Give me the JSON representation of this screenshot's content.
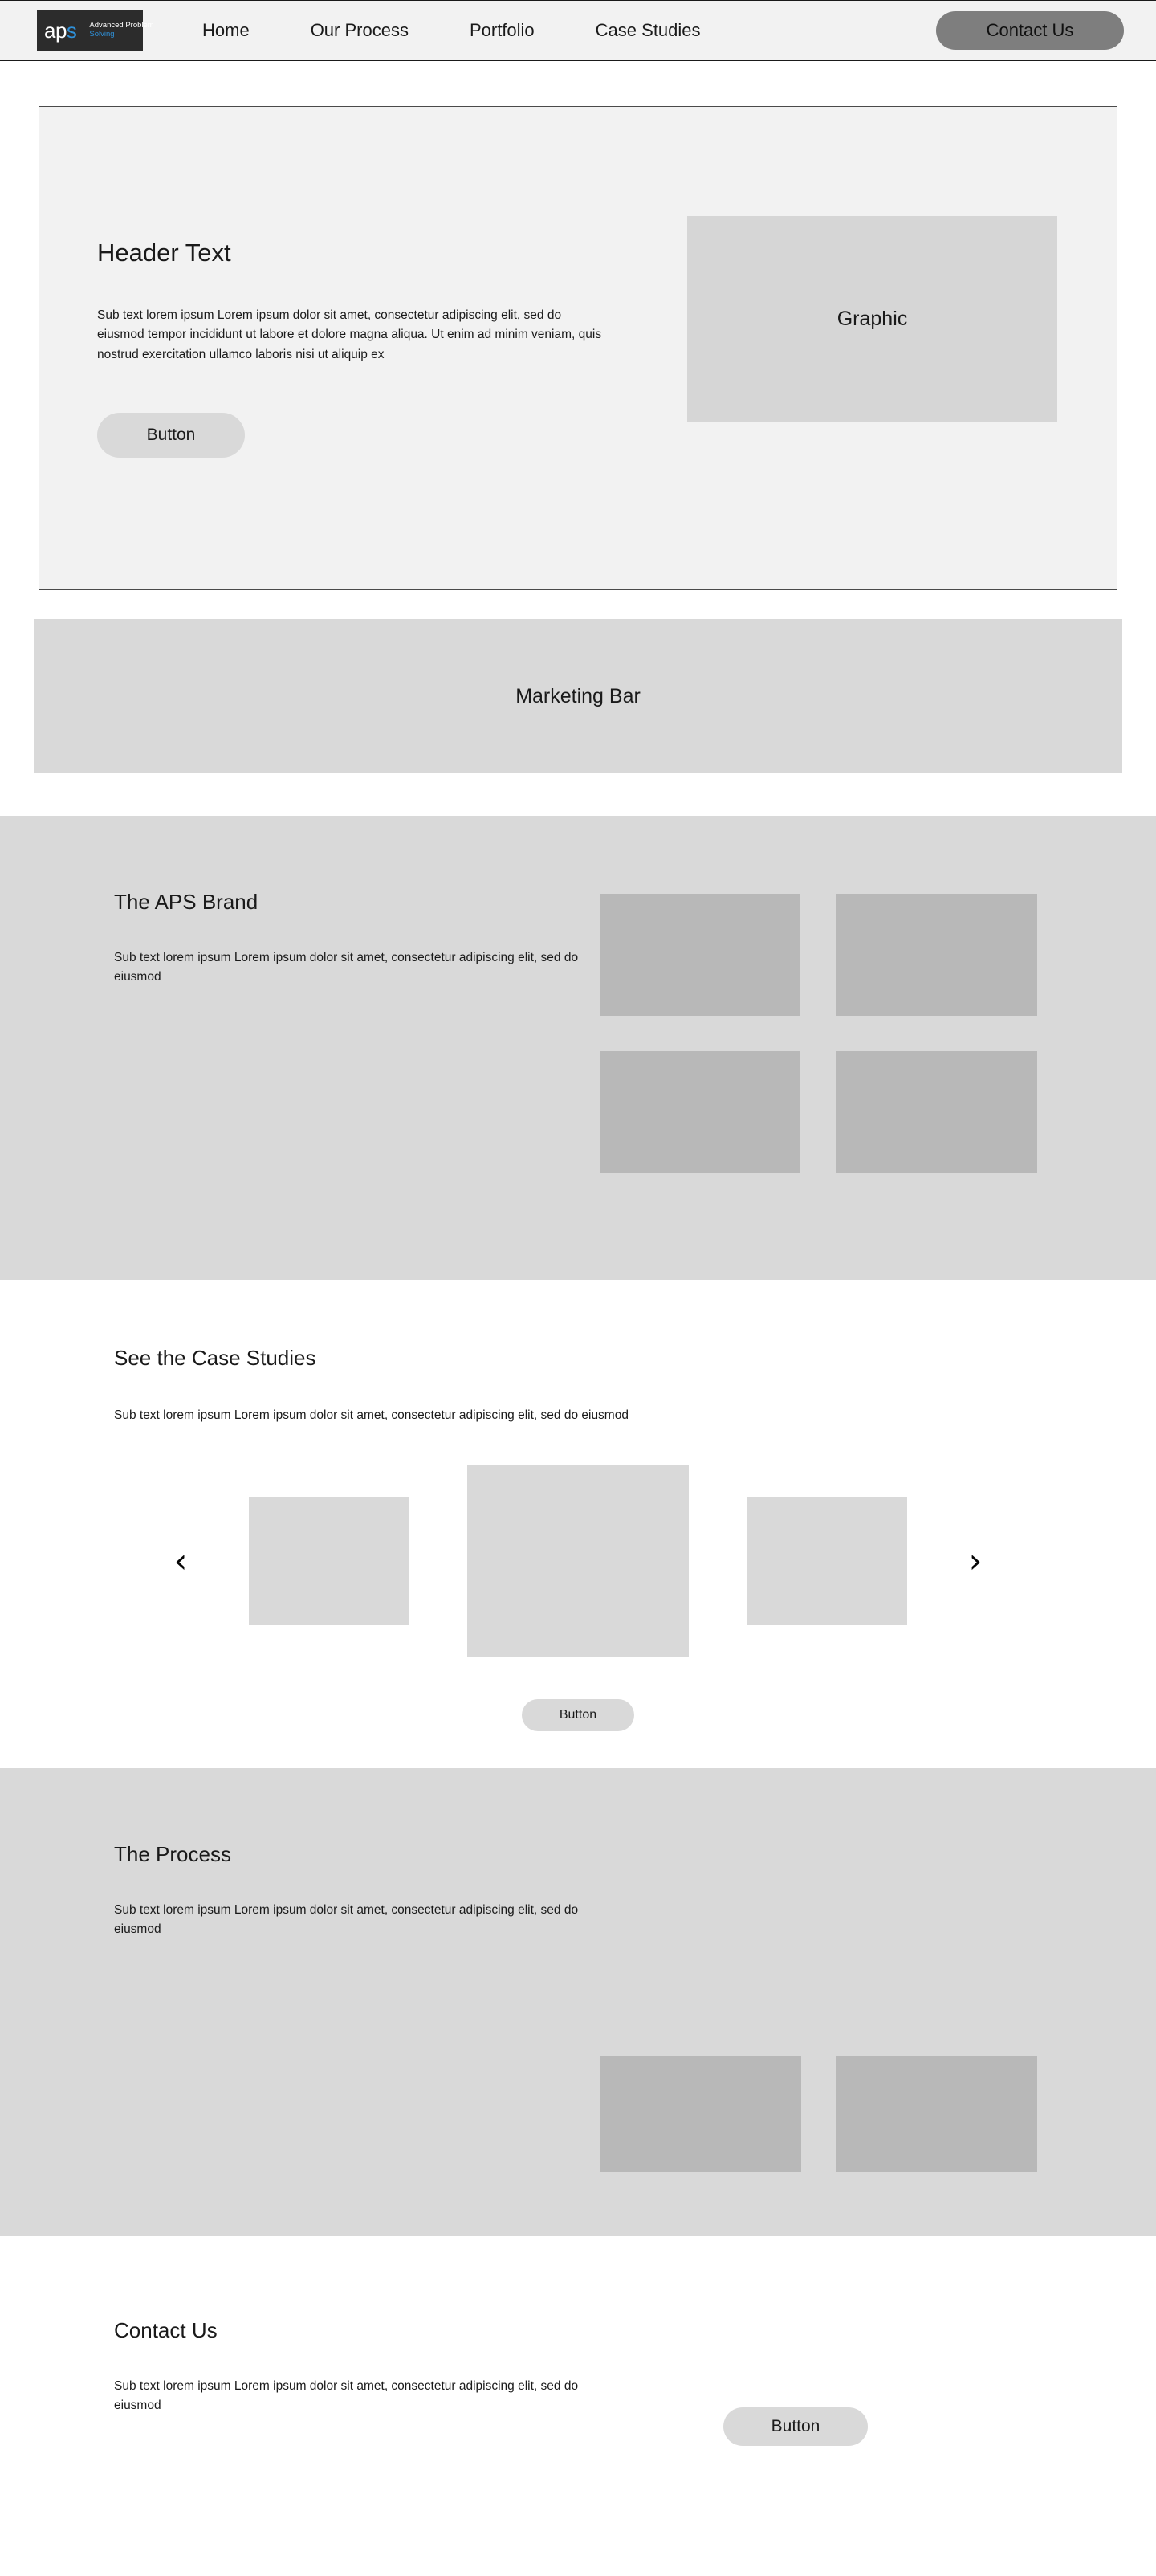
{
  "navbar": {
    "logo": {
      "mark_prefix": "ap",
      "mark_accent": "s",
      "tagline_line1": "Advanced Problem",
      "tagline_line2": "Solving"
    },
    "links": [
      {
        "label": "Home"
      },
      {
        "label": "Our Process"
      },
      {
        "label": "Portfolio"
      },
      {
        "label": "Case Studies"
      }
    ],
    "cta_label": "Contact Us",
    "cta_color": "#7e7e7e"
  },
  "hero": {
    "title": "Header Text",
    "subtext": "Sub text lorem ipsum Lorem ipsum dolor sit amet, consectetur adipiscing elit, sed do eiusmod tempor incididunt ut labore et dolore magna aliqua. Ut enim ad minim veniam, quis nostrud exercitation ullamco laboris nisi ut aliquip ex",
    "button_label": "Button",
    "graphic_label": "Graphic"
  },
  "marketing": {
    "label": "Marketing Bar"
  },
  "brand": {
    "title": "The APS Brand",
    "subtext": "Sub text lorem ipsum Lorem ipsum dolor sit amet, consectetur adipiscing elit, sed do eiusmod",
    "tiles": [
      {
        "name": "brand-image-1"
      },
      {
        "name": "brand-image-2"
      },
      {
        "name": "brand-image-3"
      },
      {
        "name": "brand-image-4"
      }
    ]
  },
  "case_studies": {
    "title": "See the Case Studies",
    "subtext": "Sub text lorem ipsum Lorem ipsum dolor sit amet, consectetur adipiscing elit, sed do eiusmod",
    "prev_icon": "‹",
    "next_icon": "›",
    "button_label": "Button"
  },
  "process": {
    "title": "The Process",
    "subtext": "Sub text lorem ipsum Lorem ipsum dolor sit amet, consectetur adipiscing elit, sed do eiusmod"
  },
  "contact": {
    "title": "Contact Us",
    "subtext": "Sub text lorem ipsum Lorem ipsum dolor sit amet, consectetur adipiscing elit, sed do eiusmod",
    "button_label": "Button"
  },
  "colors": {
    "page_bg": "#ffffff",
    "nav_bg": "#f2f2f2",
    "hero_bg": "#f2f2f2",
    "section_gray": "#d9d9d9",
    "placeholder_gray": "#b8b8b8",
    "graphic_gray": "#d6d6d6",
    "logo_bg": "#2c2c2c",
    "logo_accent": "#2f90d8",
    "text": "#1a1a1a"
  }
}
